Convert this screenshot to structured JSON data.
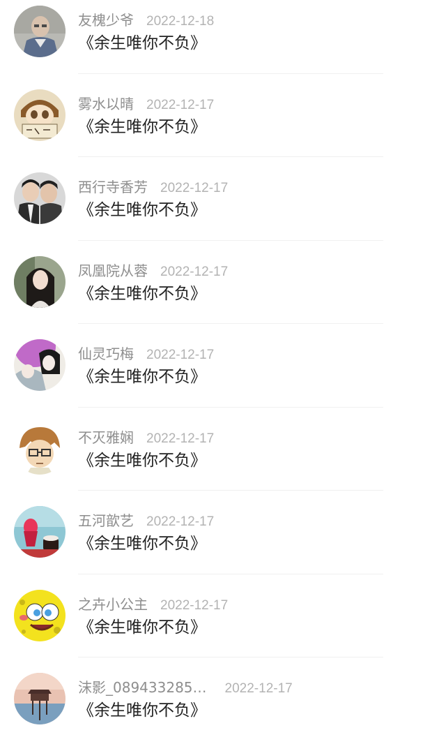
{
  "comments": [
    {
      "name": "友槐少爷",
      "date": "2022-12-18",
      "text": "《余生唯你不负》",
      "avatar_icon": "elderly-man-photo-avatar"
    },
    {
      "name": "雾水以晴",
      "date": "2022-12-17",
      "text": "《余生唯你不负》",
      "avatar_icon": "cartoon-boy-sign-avatar"
    },
    {
      "name": "西行寺香芳",
      "date": "2022-12-17",
      "text": "《余生唯你不负》",
      "avatar_icon": "two-boys-photo-avatar"
    },
    {
      "name": "凤凰院从蓉",
      "date": "2022-12-17",
      "text": "《余生唯你不负》",
      "avatar_icon": "girl-portrait-avatar"
    },
    {
      "name": "仙灵巧梅",
      "date": "2022-12-17",
      "text": "《余生唯你不负》",
      "avatar_icon": "illustrated-couple-avatar"
    },
    {
      "name": "不灭雅娴",
      "date": "2022-12-17",
      "text": "《余生唯你不负》",
      "avatar_icon": "glasses-cartoon-avatar"
    },
    {
      "name": "五河歆艺",
      "date": "2022-12-17",
      "text": "《余生唯你不负》",
      "avatar_icon": "ice-cream-avatar"
    },
    {
      "name": "之卉小公主",
      "date": "2022-12-17",
      "text": "《余生唯你不负》",
      "avatar_icon": "spongebob-avatar"
    },
    {
      "name": "沫影_089433285…",
      "date": "2022-12-17",
      "text": "《余生唯你不负》",
      "avatar_icon": "pier-sunset-avatar"
    }
  ],
  "colors": {
    "name": "#8e8e8e",
    "date": "#b3b3b3",
    "text": "#222222",
    "divider": "#f0f0f0"
  }
}
